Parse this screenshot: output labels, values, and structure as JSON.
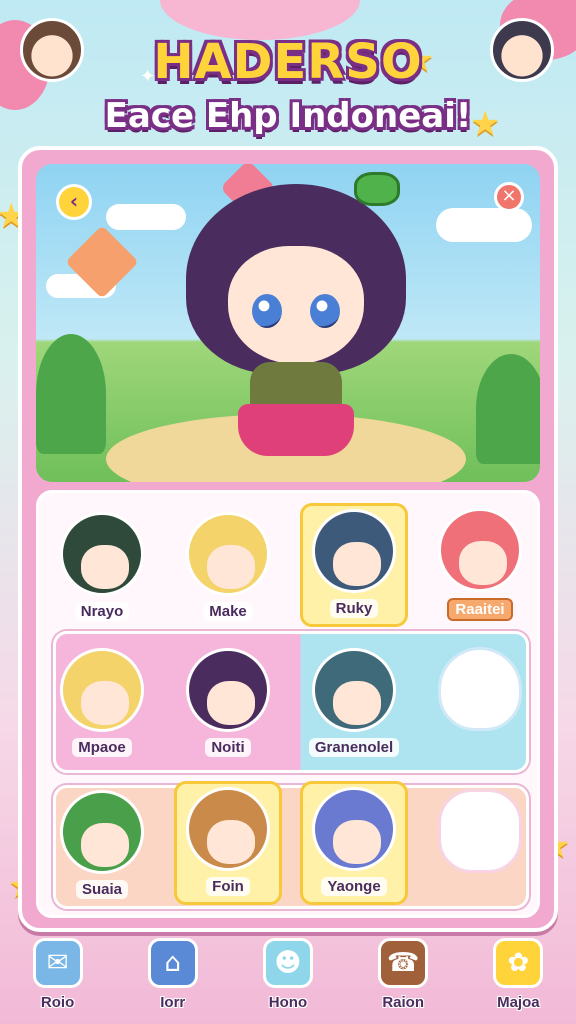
{
  "title": "HADERSO",
  "subtitle": "Eace Ehp Indoneai!",
  "roster": {
    "row1": [
      {
        "label": "Nrayo",
        "hair": "#2f4a3a",
        "selected": false,
        "tag": false
      },
      {
        "label": "Make",
        "hair": "#f4d36a",
        "selected": false,
        "tag": false
      },
      {
        "label": "Ruky",
        "hair": "#3e5a7a",
        "selected": true,
        "tag": false
      },
      {
        "label": "Raaitei",
        "hair": "#f0707a",
        "selected": false,
        "tag": true
      }
    ],
    "row2": [
      {
        "label": "Mpaoe",
        "hair": "#f4d36a",
        "selected": false
      },
      {
        "label": "Noiti",
        "hair": "#4a2d5e",
        "selected": false
      },
      {
        "label": "Granenolel",
        "hair": "#3e6a7a",
        "selected": false
      }
    ],
    "row3": [
      {
        "label": "Suaia",
        "hair": "#4aa04a",
        "selected": false
      },
      {
        "label": "Foin",
        "hair": "#c98a4a",
        "selected": true
      },
      {
        "label": "Yaonge",
        "hair": "#6a7ad0",
        "selected": true
      }
    ]
  },
  "nav": [
    {
      "label": "Roio",
      "icon": "gift-icon",
      "color": "#7ab6e6",
      "glyph": "✉"
    },
    {
      "label": "Iorr",
      "icon": "home-icon",
      "color": "#5a8ad6",
      "glyph": "⌂"
    },
    {
      "label": "Hono",
      "icon": "pet-icon",
      "color": "#8fd6ea",
      "glyph": "☻"
    },
    {
      "label": "Raion",
      "icon": "phone-icon",
      "color": "#a0603a",
      "glyph": "☎"
    },
    {
      "label": "Majoa",
      "icon": "duck-icon",
      "color": "#ffd43a",
      "glyph": "✿"
    }
  ],
  "colors": {
    "accent": "#ffd43a",
    "frame": "#f1a9cf",
    "outline": "#7a2f86"
  }
}
